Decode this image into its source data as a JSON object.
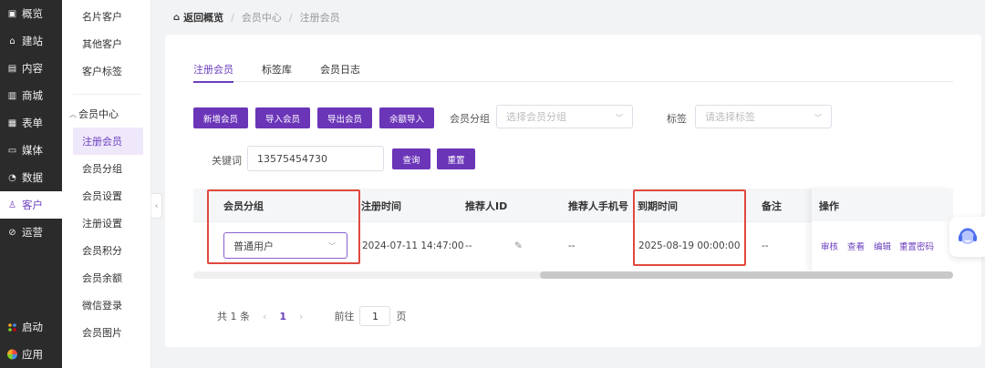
{
  "nav": {
    "items": [
      {
        "label": "概览",
        "icon": "dashboard-icon"
      },
      {
        "label": "建站",
        "icon": "home-icon"
      },
      {
        "label": "内容",
        "icon": "document-icon"
      },
      {
        "label": "商城",
        "icon": "cart-icon"
      },
      {
        "label": "表单",
        "icon": "form-icon"
      },
      {
        "label": "媒体",
        "icon": "video-icon"
      },
      {
        "label": "数据",
        "icon": "chart-icon"
      },
      {
        "label": "客户",
        "icon": "user-icon"
      },
      {
        "label": "运营",
        "icon": "link-icon"
      }
    ],
    "bottom": [
      {
        "label": "启动",
        "icon": "launch-icon"
      },
      {
        "label": "应用",
        "icon": "apps-icon"
      }
    ]
  },
  "subnav": {
    "top_items": [
      "名片客户",
      "其他客户",
      "客户标签"
    ],
    "group_label": "会员中心",
    "group_items": [
      "注册会员",
      "会员分组",
      "会员设置",
      "注册设置",
      "会员积分",
      "会员余额",
      "微信登录",
      "会员图片"
    ]
  },
  "breadcrumb": {
    "home": "返回概览",
    "level1": "会员中心",
    "level2": "注册会员"
  },
  "tabs": [
    "注册会员",
    "标签库",
    "会员日志"
  ],
  "toolbar": {
    "add_member": "新增会员",
    "import_member": "导入会员",
    "export_member": "导出会员",
    "balance_import": "余额导入",
    "group_label": "会员分组",
    "group_placeholder": "选择会员分组",
    "tag_label": "标签",
    "tag_placeholder": "请选择标签",
    "keyword_label": "关键词",
    "keyword_value": "13575454730",
    "search": "查询",
    "reset": "重置"
  },
  "table": {
    "headers": {
      "group": "会员分组",
      "reg_time": "注册时间",
      "referrer_id": "推荐人ID",
      "referrer_phone": "推荐人手机号",
      "expire_time": "到期时间",
      "remark": "备注",
      "actions": "操作"
    },
    "rows": [
      {
        "group": "普通用户",
        "reg_time": "2024-07-11 14:47:00",
        "referrer_id": "--",
        "referrer_phone": "--",
        "expire_time": "2025-08-19 00:00:00",
        "remark": "--"
      }
    ],
    "actions": [
      "审核",
      "查看",
      "编辑",
      "重置密码"
    ]
  },
  "pagination": {
    "total": "共 1 条",
    "current": "1",
    "goto_label": "前往",
    "goto_value": "1",
    "page_suffix": "页"
  },
  "colors": {
    "accent": "#6b35b8",
    "highlight_box": "#e0483e"
  }
}
